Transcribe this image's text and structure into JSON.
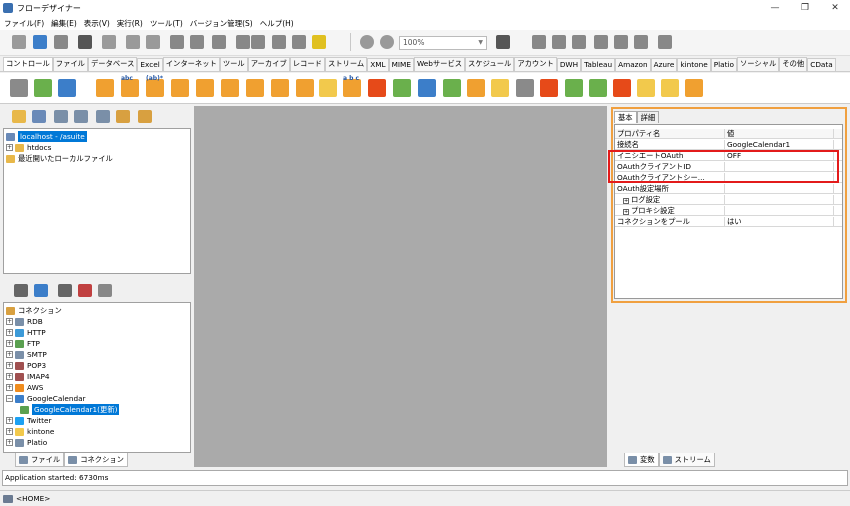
{
  "window": {
    "title": "フローデザイナー",
    "controls": [
      "—",
      "❐",
      "✕"
    ]
  },
  "menu": [
    "ファイル(F)",
    "編集(E)",
    "表示(V)",
    "実行(R)",
    "ツール(T)",
    "バージョン管理(S)",
    "ヘルプ(H)"
  ],
  "toolbar": {
    "zoom_value": "100%"
  },
  "component_tabs": [
    "コントロール",
    "ファイル",
    "データベース",
    "Excel",
    "インターネット",
    "ツール",
    "アーカイブ",
    "レコード",
    "ストリーム",
    "XML",
    "MIME",
    "Webサービス",
    "スケジュール",
    "アカウント",
    "DWH",
    "Tableau",
    "Amazon",
    "Azure",
    "kintone",
    "Platio",
    "ソーシャル",
    "その他",
    "CData"
  ],
  "component_labels": {
    "abc1": "abc",
    "abc2": "(ab)*",
    "abc3": "a b c"
  },
  "project_tree": {
    "root": "localhost - /asuite",
    "items": [
      "htdocs",
      "最近開いたローカルファイル"
    ]
  },
  "connection_tree": {
    "root": "コネクション",
    "items": [
      "RDB",
      "HTTP",
      "FTP",
      "SMTP",
      "POP3",
      "IMAP4",
      "AWS",
      "GoogleCalendar",
      "Twitter",
      "kintone",
      "Platio"
    ],
    "selected_child": "GoogleCalendar1(更新)"
  },
  "left_bottom_tabs": [
    "ファイル",
    "コネクション"
  ],
  "properties": {
    "tabs": [
      "基本",
      "詳細"
    ],
    "header": {
      "name": "プロパティ名",
      "value": "値"
    },
    "rows": [
      {
        "name": "接続名",
        "value": "GoogleCalendar1"
      },
      {
        "name": "イニシエートOAuth",
        "value": "OFF"
      },
      {
        "name": "OAuthクライアントID",
        "value": ""
      },
      {
        "name": "OAuthクライアントシー...",
        "value": ""
      },
      {
        "name": "OAuth設定場所",
        "value": ""
      },
      {
        "name": "ログ設定",
        "value": ""
      },
      {
        "name": "プロキシ設定",
        "value": ""
      },
      {
        "name": "コネクションをプール",
        "value": "はい"
      }
    ]
  },
  "right_bottom_tabs": [
    "変数",
    "ストリーム"
  ],
  "status": {
    "message": "Application started: 6730ms",
    "path": "<HOME>"
  }
}
